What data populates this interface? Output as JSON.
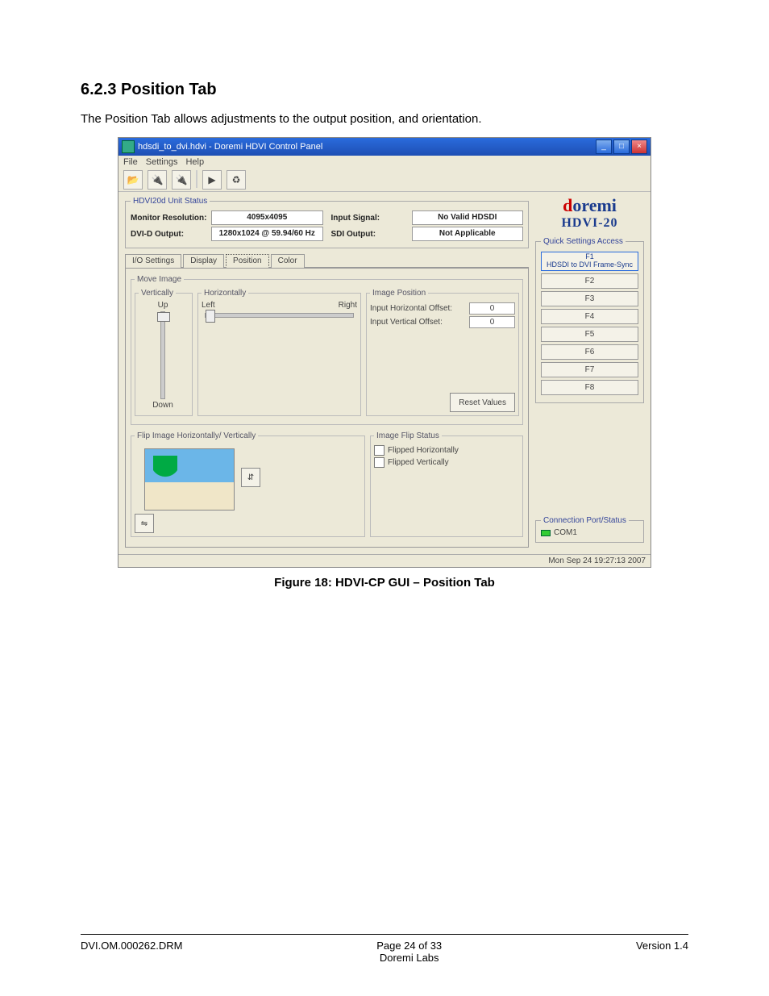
{
  "doc": {
    "heading": "6.2.3  Position Tab",
    "intro": "The Position Tab allows adjustments to the output position, and orientation.",
    "figure_prefix": "Figure",
    "figure_num": "18",
    "figure_sep": ":",
    "figure_title": "HDVI-CP GUI – Position Tab",
    "footer": {
      "left": "DVI.OM.000262.DRM",
      "center1": "Page 24 of 33",
      "center2": "Doremi Labs",
      "right": "Version 1.4"
    }
  },
  "app": {
    "title": "hdsdi_to_dvi.hdvi - Doremi HDVI Control Panel",
    "menu": [
      "File",
      "Settings",
      "Help"
    ],
    "status": {
      "legend": "HDVI20d Unit Status",
      "monitor_res_label": "Monitor Resolution:",
      "monitor_res_value": "4095x4095",
      "dvid_label": "DVI-D Output:",
      "dvid_value": "1280x1024 @ 59.94/60 Hz",
      "input_signal_label": "Input Signal:",
      "input_signal_value": "No Valid HDSDI",
      "sdi_label": "SDI Output:",
      "sdi_value": "Not Applicable"
    },
    "tabs": [
      "I/O Settings",
      "Display",
      "Position",
      "Color"
    ],
    "position": {
      "move_image_legend": "Move Image",
      "vert_legend": "Vertically",
      "up": "Up",
      "down": "Down",
      "horiz_legend": "Horizontally",
      "left": "Left",
      "right": "Right",
      "img_pos_legend": "Image Position",
      "h_offset_label": "Input Horizontal Offset:",
      "h_offset_value": "0",
      "v_offset_label": "Input Vertical Offset:",
      "v_offset_value": "0",
      "reset_btn": "Reset Values",
      "flip_legend": "Flip Image Horizontally/ Vertically",
      "flip_status_legend": "Image Flip Status",
      "flipped_h": "Flipped Horizontally",
      "flipped_v": "Flipped Vertically"
    },
    "brand": {
      "d": "d",
      "oremi": "oremi",
      "sub": "HDVI-20"
    },
    "quick": {
      "legend": "Quick Settings Access",
      "items": [
        {
          "name": "F1",
          "desc": "HDSDI to DVI Frame-Sync"
        },
        {
          "name": "F2"
        },
        {
          "name": "F3"
        },
        {
          "name": "F4"
        },
        {
          "name": "F5"
        },
        {
          "name": "F6"
        },
        {
          "name": "F7"
        },
        {
          "name": "F8"
        }
      ]
    },
    "conn": {
      "legend": "Connection Port/Status",
      "port": "COM1"
    },
    "statusbar": "Mon Sep 24 19:27:13 2007"
  }
}
